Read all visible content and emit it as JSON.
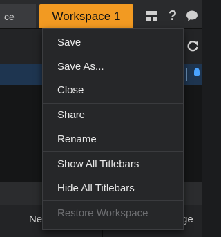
{
  "header": {
    "left_tab_label": "ce",
    "workspace_tab_label": "Workspace 1",
    "help_glyph": "?"
  },
  "icons": {
    "layout": "layout-icon",
    "help": "help-icon",
    "chat": "chat-bubble-icon",
    "refresh": "refresh-icon",
    "location": "location-pin-icon"
  },
  "table": {
    "left_header_partial": "Ne",
    "right_header_partial": "ge"
  },
  "menu": {
    "items": [
      {
        "label": "Save",
        "enabled": true
      },
      {
        "label": "Save As...",
        "enabled": true
      },
      {
        "label": "Close",
        "enabled": true
      },
      {
        "label": "Share",
        "enabled": true
      },
      {
        "label": "Rename",
        "enabled": true
      },
      {
        "label": "Show All Titlebars",
        "enabled": true
      },
      {
        "label": "Hide All Titlebars",
        "enabled": true
      },
      {
        "label": "Restore Workspace",
        "enabled": false
      }
    ]
  },
  "colors": {
    "accent_tab": "#f29a22",
    "menu_bg": "#262729",
    "menu_text": "#e8e8e8",
    "menu_text_disabled": "#6e6f72",
    "highlight_row": "#1e3550"
  }
}
